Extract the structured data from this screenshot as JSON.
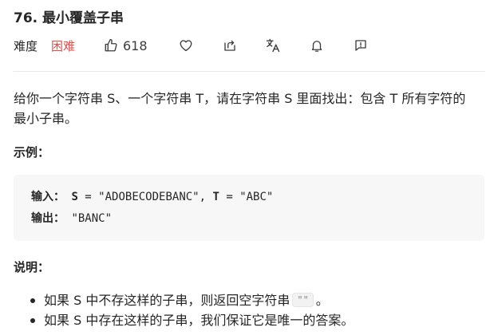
{
  "problem": {
    "title": "76. 最小覆盖子串",
    "difficulty_label": "难度",
    "difficulty_value": "困难",
    "like_count": "618"
  },
  "icons": {
    "like": "thumbs-up-icon",
    "favorite": "heart-icon",
    "share": "share-icon",
    "translate": "translate-icon",
    "notify": "bell-icon",
    "feedback": "feedback-icon"
  },
  "description": "给你一个字符串 S、一个字符串 T，请在字符串 S 里面找出：包含 T 所有字符的最小子串。",
  "example": {
    "heading": "示例：",
    "input_label": "输入：",
    "input_s_name": "S",
    "input_s_value": "\"ADOBECODEBANC\"",
    "input_t_name": "T",
    "input_t_value": "\"ABC\"",
    "output_label": "输出：",
    "output_value": "\"BANC\""
  },
  "notes": {
    "heading": "说明：",
    "item1_before": "如果 S 中不存这样的子串，则返回空字符串",
    "item1_code": "\"\"",
    "item1_after": "。",
    "item2": "如果 S 中存在这样的子串，我们保证它是唯一的答案。"
  },
  "colors": {
    "difficulty_hard": "#ef4743",
    "code_bg": "#f7f7f8",
    "text": "#262626"
  }
}
